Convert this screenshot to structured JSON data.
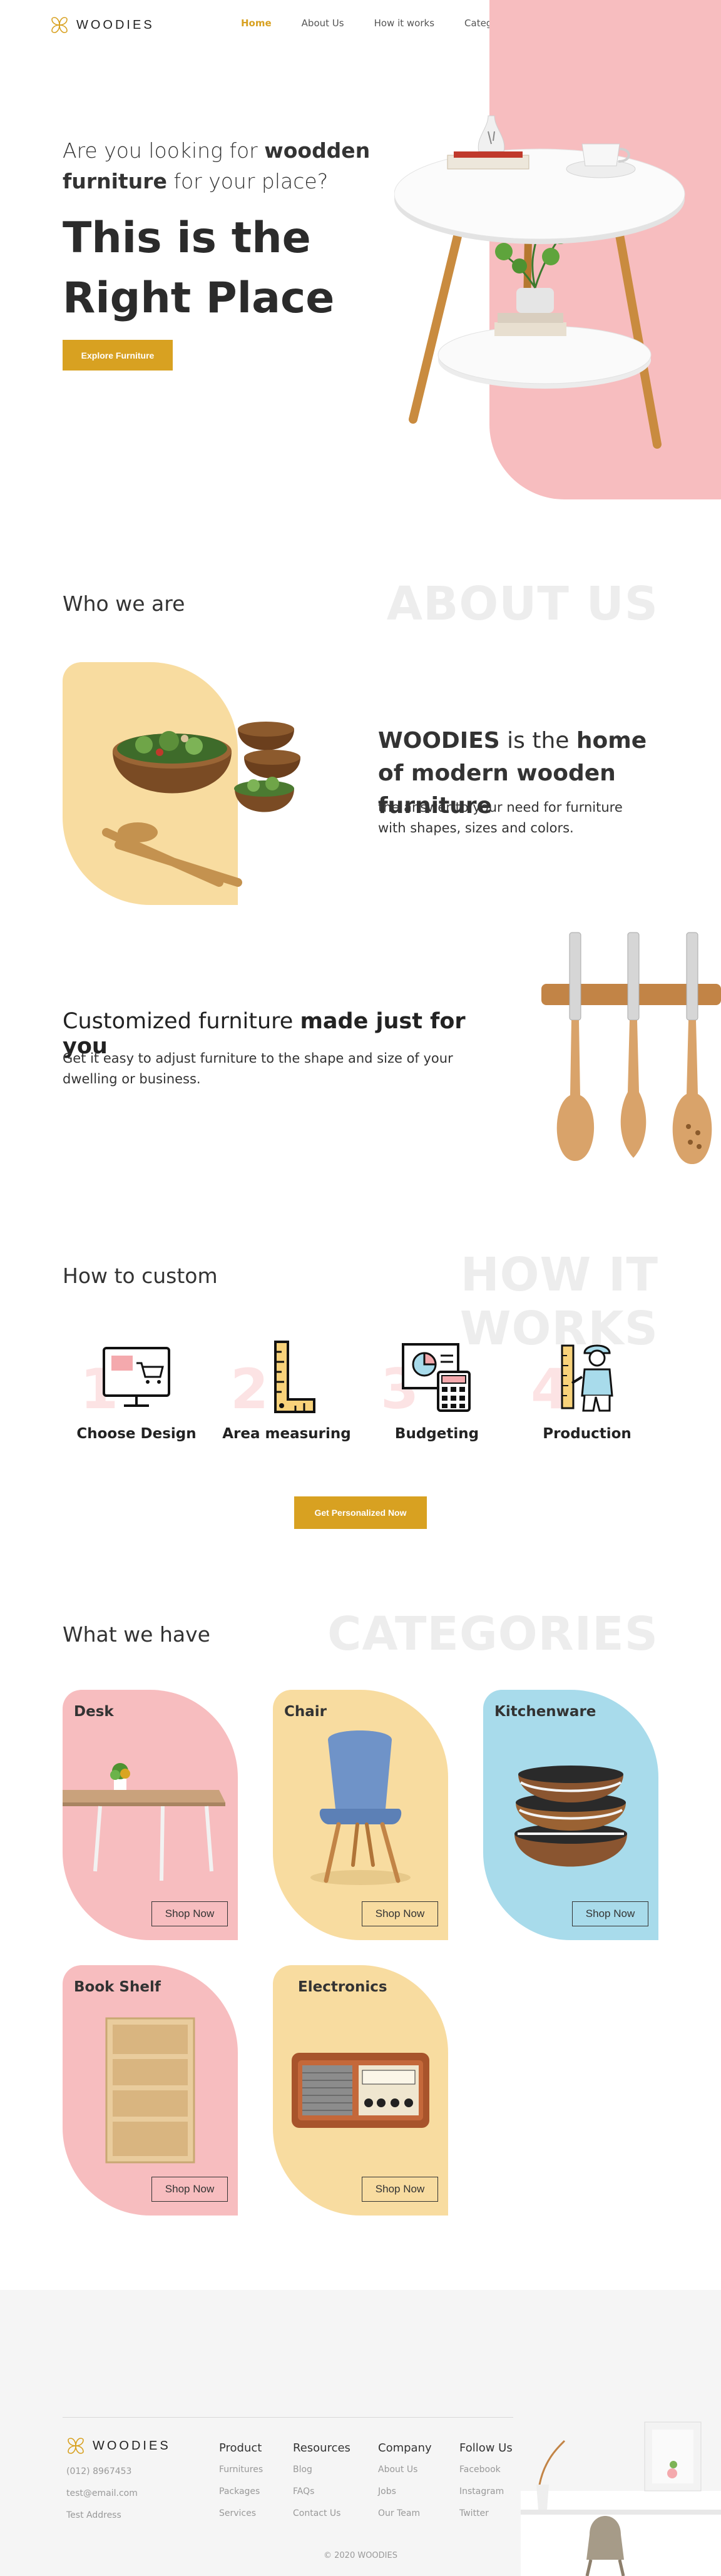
{
  "brand": {
    "name": "WOODIES",
    "accent": "#D8A121"
  },
  "nav": {
    "items": [
      "Home",
      "About Us",
      "How it works",
      "Categories"
    ],
    "active": "Home"
  },
  "hero": {
    "subtitle_a": "Are you looking for ",
    "subtitle_b": "woodden furniture",
    "subtitle_c": " for your place?",
    "title_line1": "This is the",
    "title_line2": "Right Place",
    "cta": "Explore Furniture"
  },
  "about": {
    "heading": "Who we are",
    "ghost": "ABOUT US",
    "title_a": "WOODIES",
    "title_b": " is the ",
    "title_c": "home of modern wooden furniture",
    "desc": "the answer to your need for furniture with shapes, sizes and colors."
  },
  "custom": {
    "title_a": "Customized furniture ",
    "title_b": "made just for you",
    "desc": "Get it easy to adjust furniture to the shape and size of your dwelling or business."
  },
  "how": {
    "heading": "How to custom",
    "ghost": "HOW IT WORKS",
    "steps": [
      {
        "num": "1",
        "label": "Choose Design",
        "icon": "monitor-cart-icon"
      },
      {
        "num": "2",
        "label": "Area measuring",
        "icon": "ruler-icon"
      },
      {
        "num": "3",
        "label": "Budgeting",
        "icon": "calculator-chart-icon"
      },
      {
        "num": "4",
        "label": "Production",
        "icon": "worker-icon"
      }
    ],
    "cta": "Get Personalized Now"
  },
  "categories": {
    "heading": "What we have",
    "ghost": "CATEGORIES",
    "items": [
      {
        "name": "Desk",
        "button": "Shop Now",
        "color": "#F7BDBF"
      },
      {
        "name": "Chair",
        "button": "Shop Now",
        "color": "#F8DCA0"
      },
      {
        "name": "Kitchenware",
        "button": "Shop Now",
        "color": "#A8DBEB"
      },
      {
        "name": "Book Shelf",
        "button": "Shop Now",
        "color": "#F7BDBF"
      },
      {
        "name": "Electronics",
        "button": "Shop Now",
        "color": "#F8DCA0"
      }
    ]
  },
  "footer": {
    "phone": "(012) 8967453",
    "email": "test@email.com",
    "address": "Test Address",
    "columns": [
      {
        "title": "Product",
        "links": [
          "Furnitures",
          "Packages",
          "Services"
        ]
      },
      {
        "title": "Resources",
        "links": [
          "Blog",
          "FAQs",
          "Contact Us"
        ]
      },
      {
        "title": "Company",
        "links": [
          "About Us",
          "Jobs",
          "Our Team"
        ]
      },
      {
        "title": "Follow Us",
        "links": [
          "Facebook",
          "Instagram",
          "Twitter"
        ]
      }
    ],
    "copyright": "© 2020 WOODIES"
  }
}
